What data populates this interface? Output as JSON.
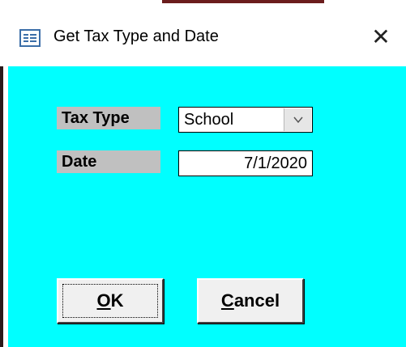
{
  "window": {
    "title": "Get Tax Type and Date",
    "close_glyph": "✕"
  },
  "form": {
    "tax_type": {
      "label": "Tax Type",
      "value": "School"
    },
    "date": {
      "label": "Date",
      "value": "7/1/2020"
    }
  },
  "buttons": {
    "ok": {
      "accel": "O",
      "rest": "K"
    },
    "cancel": {
      "accel": "C",
      "rest": "ancel"
    }
  },
  "colors": {
    "client_background": "#00ffff",
    "label_background": "#c0c0c0",
    "icon_blue": "#3b6ea8"
  },
  "icons": {
    "title": "form-window-icon",
    "close": "close-icon",
    "dropdown": "chevron-down-icon"
  }
}
